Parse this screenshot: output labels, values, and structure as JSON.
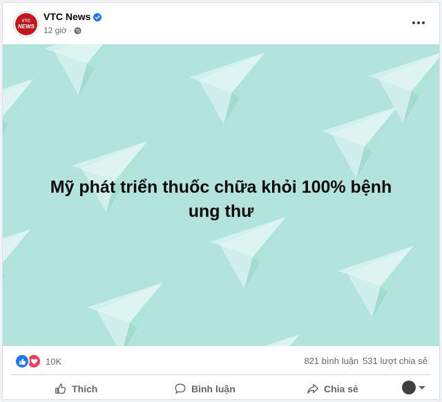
{
  "post": {
    "page_name": "VTC News",
    "time": "12 giờ",
    "avatar_text_top": "VTC",
    "avatar_text_bottom": "NEWS",
    "headline_line1": "Mỹ phát triển thuốc chữa khỏi 100% bệnh",
    "headline_line2": "ung thư"
  },
  "stats": {
    "reaction_count": "10K",
    "comments": "821 bình luận",
    "shares": "531 lượt chia sẻ"
  },
  "actions": {
    "like": "Thích",
    "comment": "Bình luận",
    "share": "Chia sẻ"
  },
  "icons": {
    "verified": "verified-badge-icon",
    "privacy": "globe-icon",
    "more": "more-options-icon",
    "like": "thumbs-up-icon",
    "comment": "comment-bubble-icon",
    "share": "share-arrow-icon"
  },
  "colors": {
    "image_background": "#b2e4dd",
    "accent": "#1877f2",
    "love": "#f33e58"
  }
}
